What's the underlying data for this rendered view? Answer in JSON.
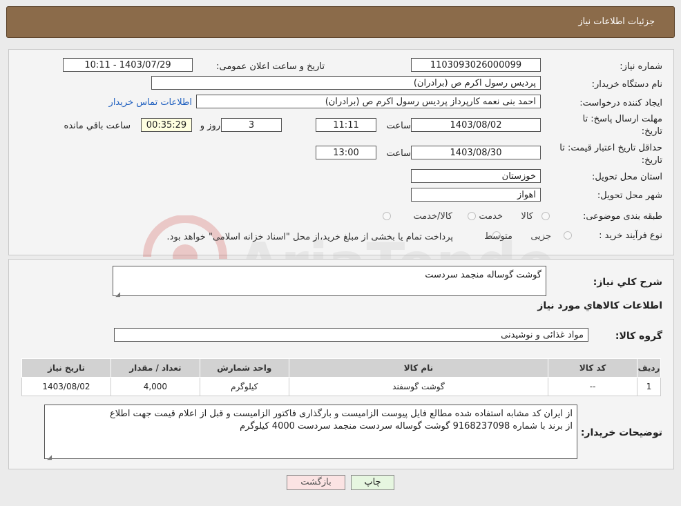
{
  "header": {
    "title": "جزئیات اطلاعات نیاز"
  },
  "form": {
    "need_number": {
      "label": "شماره نیاز:",
      "value": "1103093026000099"
    },
    "announce": {
      "label": "تاریخ و ساعت اعلان عمومی:",
      "value": "1403/07/29 - 10:11"
    },
    "buyer": {
      "label": "نام دستگاه خریدار:",
      "value": "پردیس رسول اکرم ص (برادران)"
    },
    "creator": {
      "label": "ایجاد کننده درخواست:",
      "value": "احمد بنی نعمه کارپرداز پردیس رسول اکرم ص (برادران)",
      "contact_link": "اطلاعات تماس خریدار"
    },
    "deadline": {
      "label_line1": "مهلت ارسال پاسخ: تا",
      "label_line2": "تاریخ:",
      "date": "1403/08/02",
      "time_label": "ساعت",
      "time": "11:11",
      "days": "3",
      "days_label": "روز و",
      "remaining": "00:35:29",
      "remaining_label": "ساعت باقي مانده"
    },
    "validity": {
      "label_line1": "حداقل تاریخ اعتبار قیمت: تا",
      "label_line2": "تاریخ:",
      "date": "1403/08/30",
      "time_label": "ساعت",
      "time": "13:00"
    },
    "province": {
      "label": "استان محل تحویل:",
      "value": "خوزستان"
    },
    "city": {
      "label": "شهر محل تحویل:",
      "value": "اهواز"
    },
    "category": {
      "label": "طبقه بندی موضوعی:",
      "options": [
        "کالا",
        "خدمت",
        "کالا/خدمت"
      ]
    },
    "process": {
      "label": "نوع فرآیند خرید :",
      "options": [
        "جزیی",
        "متوسط"
      ],
      "note": "پرداخت تمام یا بخشی از مبلغ خرید،از محل \"اسناد خزانه اسلامی\" خواهد بود."
    }
  },
  "details": {
    "summary_label": "شرح کلي نياز:",
    "summary_value": "گوشت گوساله منجمد سردست",
    "items_title": "اطلاعات کالاهاي مورد نياز",
    "group_label": "گروه کالا:",
    "group_value": "مواد غذائی و نوشیدنی",
    "table": {
      "headers": [
        "رديف",
        "کد کالا",
        "نام کالا",
        "واحد شمارش",
        "تعداد / مقدار",
        "تاریخ نیاز"
      ],
      "rows": [
        [
          "1",
          "--",
          "گوشت گوسفند",
          "کیلوگرم",
          "4,000",
          "1403/08/02"
        ]
      ]
    },
    "buyer_notes_label": "توضیحات خریدار:",
    "buyer_notes_line1": "از ایران کد مشابه استفاده شده مطالع فایل پیوست الزامیست و بارگذاری فاکتور الزامیست و قبل از اعلام قیمت جهت اطلاع",
    "buyer_notes_line2": "از برند با شماره 9168237098  گوشت گوساله سردست منجمد سردست  4000 کیلوگرم"
  },
  "buttons": {
    "print": "چاپ",
    "back": "بازگشت"
  },
  "colors": {
    "header_bg": "#8b6b4a",
    "link": "#1f5fbf",
    "print_bg": "#e6f6e0",
    "back_bg": "#fbe3e3"
  }
}
